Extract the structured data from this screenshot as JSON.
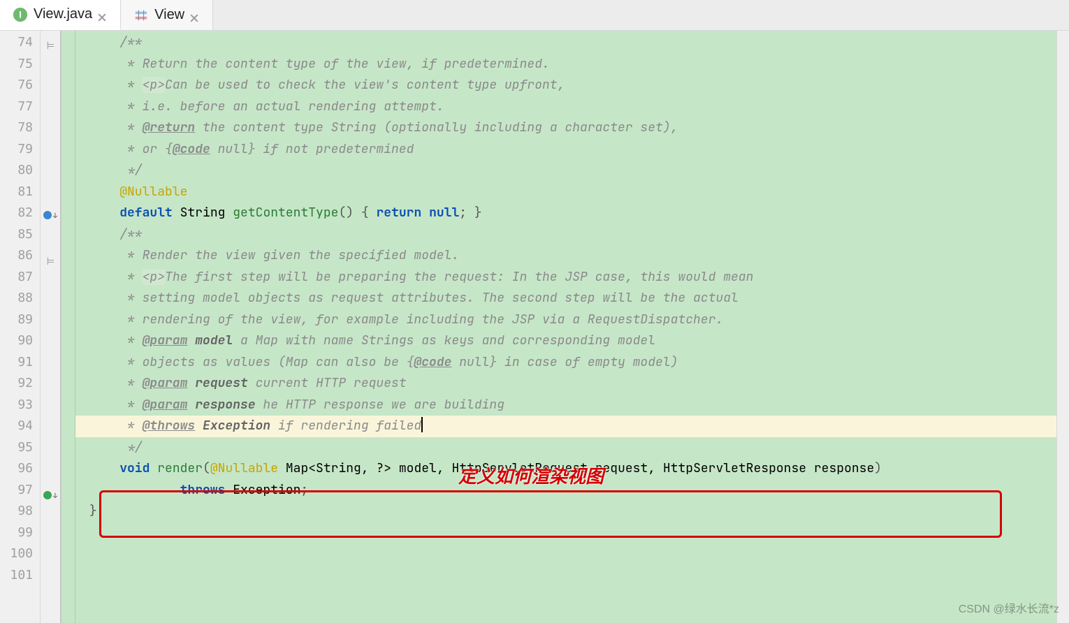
{
  "tabs": [
    {
      "label": "View.java",
      "icon": "java-interface-icon"
    },
    {
      "label": "View",
      "icon": "java-class-icon"
    }
  ],
  "gutter": {
    "lines": [
      "74",
      "75",
      "76",
      "77",
      "78",
      "79",
      "80",
      "81",
      "82",
      "85",
      "86",
      "87",
      "88",
      "89",
      "90",
      "91",
      "92",
      "93",
      "94",
      "95",
      "96",
      "97",
      "98",
      "99",
      "100",
      "101"
    ],
    "marks": {
      "82": "override-blue",
      "97": "warning-green"
    },
    "folds": {
      "74": "fold-mark",
      "86": "fold-mark"
    }
  },
  "code": {
    "l74": {
      "comment_open": "/**"
    },
    "l75": {
      "star": " * ",
      "text": "Return the content type of the view, if predetermined."
    },
    "l76": {
      "star": " * ",
      "tag_open": "<p>",
      "text": "Can be used to check the view's content type upfront,"
    },
    "l77": {
      "star": " * ",
      "text": "i.e. before an actual rendering attempt."
    },
    "l78": {
      "star": " * ",
      "tag": "@return",
      "text": " the content type String (optionally including a character set),"
    },
    "l79": {
      "star": " * ",
      "text_a": "or {",
      "tag": "@code",
      "text_b": " null} if not predetermined"
    },
    "l80": {
      "comment_close": " */"
    },
    "l81": {
      "annotation": "@Nullable"
    },
    "l82": {
      "kw_default": "default",
      "type": "String",
      "method": "getContentType",
      "parens": "()",
      "brace_open": " { ",
      "kw_return": "return",
      "kw_null": " null",
      "semi": "; ",
      "brace_close": "}"
    },
    "l85": {
      "blank": ""
    },
    "l86": {
      "comment_open": "/**"
    },
    "l87": {
      "star": " * ",
      "text": "Render the view given the specified model."
    },
    "l88": {
      "star": " * ",
      "tag_open": "<p>",
      "text": "The first step will be preparing the request: In the JSP case, this would mean"
    },
    "l89": {
      "star": " * ",
      "text": "setting model objects as request attributes. The second step will be the actual"
    },
    "l90": {
      "star": " * ",
      "text": "rendering of the view, for example including the JSP via a RequestDispatcher."
    },
    "l91": {
      "star": " * ",
      "tag": "@param",
      "bold": " model",
      "text": " a Map with name Strings as keys and corresponding model"
    },
    "l92": {
      "star": " * ",
      "text_a": "objects as values (Map can also be {",
      "tag": "@code",
      "text_b": " null} in case of empty model)"
    },
    "l93": {
      "star": " * ",
      "tag": "@param",
      "bold": " request",
      "text": " current HTTP request"
    },
    "l94": {
      "star": " * ",
      "tag": "@param",
      "bold": " response",
      "text": " he HTTP response we are building"
    },
    "l95": {
      "star": " * ",
      "tag": "@throws",
      "bold": " Exception",
      "text": " if rendering failed"
    },
    "l96": {
      "comment_close": " */"
    },
    "l97": {
      "kw_void": "void",
      "method": "render",
      "paren_open": "(",
      "annotation": "@Nullable",
      "sp1": " ",
      "type_map": "Map<String, ?>",
      "arg1": " model, ",
      "type_req": "HttpServletRequest",
      "arg2": " request, ",
      "type_res": "HttpServletResponse",
      "arg3": " response",
      "paren_close": ")"
    },
    "l98": {
      "kw_throws": "throws",
      "type_exc": " Exception",
      "semi": ";"
    },
    "l99": {
      "blank": ""
    },
    "l100": {
      "brace": "}"
    },
    "l101": {
      "blank": ""
    }
  },
  "overlay": {
    "annotation_text": "定义如何渲染视图"
  },
  "watermark": "CSDN @绿水长流*z"
}
